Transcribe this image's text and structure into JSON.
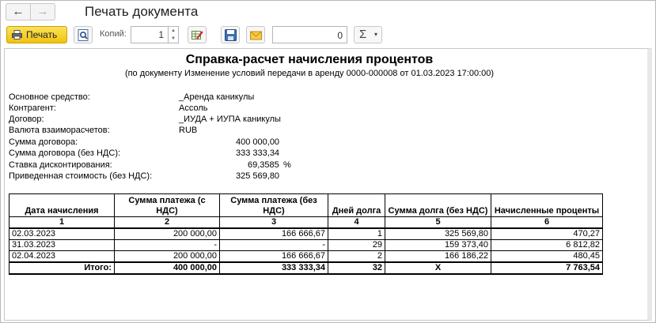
{
  "window": {
    "title": "Печать документа",
    "nav_back": "←",
    "nav_forward": "→"
  },
  "toolbar": {
    "print_label": "Печать",
    "copies_label": "Копий:",
    "copies_value": "1",
    "field_value": "0",
    "sum_symbol": "Σ",
    "sum_caret": "▾"
  },
  "document": {
    "title": "Справка-расчет начисления процентов",
    "subtitle": "(по документу Изменение условий передачи в аренду 0000-000008 от 01.03.2023 17:00:00)",
    "info": [
      {
        "label": "Основное средство:",
        "value": "_Аренда каникулы"
      },
      {
        "label": "Контрагент:",
        "value": "Ассоль"
      },
      {
        "label": "Договор:",
        "value": "_ИУДА + ИУПА каникулы"
      },
      {
        "label": "Валюта взаиморасчетов:",
        "value": "RUB"
      },
      {
        "label": "Сумма договора:",
        "value": "400 000,00"
      },
      {
        "label": "Сумма договора (без НДС):",
        "value": "333 333,34"
      },
      {
        "label": "Ставка дисконтирования:",
        "value": "69,3585",
        "unit": "%"
      },
      {
        "label": "Приведенная стоимость (без НДС):",
        "value": "325 569,80"
      }
    ],
    "table": {
      "headers": [
        "Дата начисления",
        "Сумма платежа (с НДС)",
        "Сумма платежа (без НДС)",
        "Дней долга",
        "Сумма долга (без НДС)",
        "Начисленные проценты"
      ],
      "column_numbers": [
        "1",
        "2",
        "3",
        "4",
        "5",
        "6"
      ],
      "rows": [
        [
          "02.03.2023",
          "200 000,00",
          "166 666,67",
          "1",
          "325 569,80",
          "470,27"
        ],
        [
          "31.03.2023",
          "-",
          "-",
          "29",
          "159 373,40",
          "6 812,82"
        ],
        [
          "02.04.2023",
          "200 000,00",
          "166 666,67",
          "2",
          "166 186,22",
          "480,45"
        ]
      ],
      "total": [
        "Итого:",
        "400 000,00",
        "333 333,34",
        "32",
        "X",
        "7 763,54"
      ]
    }
  },
  "colors": {
    "print_button": "#f2c20f",
    "border": "#b8b8b8"
  }
}
